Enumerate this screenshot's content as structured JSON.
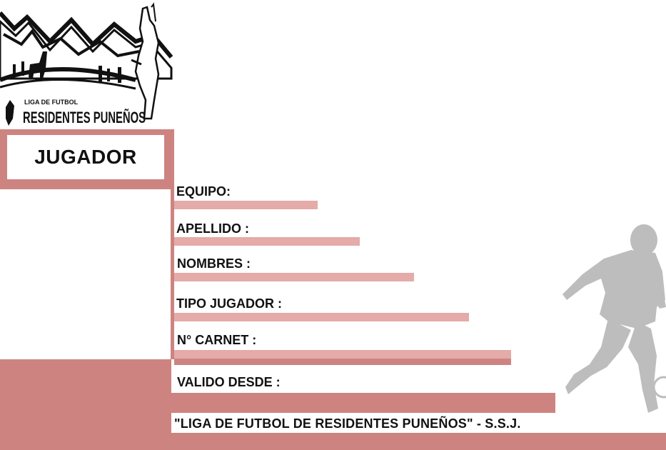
{
  "logo": {
    "small_text": "LIGA DE FUTBOL",
    "big_text": "RESIDENTES PUNEÑOS"
  },
  "role": "JUGADOR",
  "fields": {
    "equipo": "EQUIPO:",
    "apellido": "APELLIDO :",
    "nombres": "NOMBRES :",
    "tipo_jugador": "TIPO JUGADOR :",
    "carnet": "N° CARNET :",
    "valido_desde": "VALIDO DESDE :"
  },
  "footer": "\"LIGA DE FUTBOL DE RESIDENTES PUNEÑOS\" - S.S.J.",
  "colors": {
    "accent": "#cd8480",
    "bar_light": "#e4aba8",
    "player_silhouette": "#bdbdbd"
  }
}
